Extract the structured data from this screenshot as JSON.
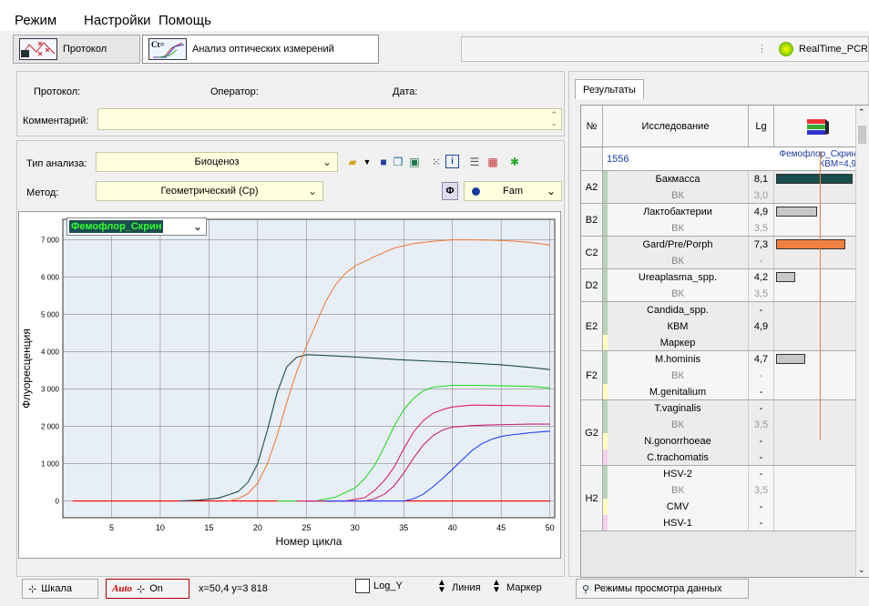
{
  "menu": {
    "items": [
      "Режим",
      "Настройки",
      "Помощь"
    ]
  },
  "toolbar": {
    "tab_protocol": "Протокол",
    "tab_analysis": "Анализ оптических измерений",
    "tab_analysis_icon_text": "Ct=",
    "realtime": "RealTime_PCR"
  },
  "info": {
    "protocol_label": "Протокол:",
    "operator_label": "Оператор:",
    "date_label": "Дата:",
    "comment_label": "Комментарий:"
  },
  "analysis": {
    "type_label": "Тип анализа:",
    "type_value": "Биоценоз",
    "method_label": "Метод:",
    "method_value": "Геометрический (Cp)",
    "channel_value": "Fam",
    "phi_symbol": "Φ"
  },
  "chart_selector": "Фемофлор_Скрин",
  "chart_data": {
    "type": "line",
    "xlabel": "Номер цикла",
    "ylabel": "Флуоресценция",
    "xlim": [
      0,
      50.5
    ],
    "ylim": [
      -450,
      7550
    ],
    "x_ticks": [
      5,
      10,
      15,
      20,
      25,
      30,
      35,
      40,
      45,
      50
    ],
    "y_ticks": [
      0,
      1000,
      2000,
      3000,
      4000,
      5000,
      6000,
      7000
    ],
    "y_tick_labels": [
      "0",
      "1 000",
      "2 000",
      "3 000",
      "4 000",
      "5 000",
      "6 000",
      "7 000"
    ],
    "grid": true,
    "series": [
      {
        "color": "#ff0000",
        "x": [
          1,
          10,
          20,
          30,
          40,
          50
        ],
        "y": [
          0,
          0,
          0,
          0,
          0,
          0
        ]
      },
      {
        "color": "#1a4d4d",
        "x": [
          12,
          14,
          16,
          18,
          19,
          20,
          21,
          22,
          23,
          24,
          25,
          27,
          30,
          35,
          40,
          45,
          48,
          50
        ],
        "y": [
          0,
          20,
          80,
          250,
          500,
          1000,
          1900,
          2900,
          3600,
          3850,
          3920,
          3900,
          3860,
          3780,
          3720,
          3650,
          3580,
          3520
        ]
      },
      {
        "color": "#f08040",
        "x": [
          17,
          18,
          19,
          20,
          21,
          22,
          23,
          24,
          25,
          26,
          27,
          28,
          29,
          30,
          32,
          34,
          36,
          38,
          40,
          42,
          44,
          46,
          48,
          50
        ],
        "y": [
          0,
          60,
          200,
          480,
          1000,
          1750,
          2650,
          3450,
          4150,
          4750,
          5350,
          5800,
          6100,
          6300,
          6550,
          6780,
          6900,
          6960,
          7000,
          7000,
          6990,
          6970,
          6930,
          6860
        ]
      },
      {
        "color": "#22dd22",
        "x": [
          22,
          26,
          28,
          30,
          31,
          32,
          33,
          34,
          35,
          36,
          37,
          38,
          40,
          42,
          45,
          48,
          50
        ],
        "y": [
          0,
          0,
          100,
          350,
          600,
          950,
          1450,
          2000,
          2450,
          2750,
          2950,
          3050,
          3100,
          3100,
          3090,
          3070,
          3030
        ]
      },
      {
        "color": "#e0206a",
        "x": [
          24,
          29,
          31,
          32,
          33,
          34,
          35,
          36,
          37,
          38,
          39,
          40,
          42,
          45,
          48,
          50
        ],
        "y": [
          0,
          0,
          90,
          280,
          550,
          900,
          1400,
          1850,
          2150,
          2350,
          2450,
          2520,
          2570,
          2560,
          2550,
          2540
        ]
      },
      {
        "color": "#c8207a",
        "x": [
          25,
          31,
          32,
          33,
          34,
          35,
          36,
          37,
          38,
          39,
          40,
          42,
          44,
          46,
          48,
          50
        ],
        "y": [
          0,
          0,
          60,
          180,
          400,
          750,
          1150,
          1500,
          1750,
          1900,
          1980,
          2020,
          2040,
          2050,
          2060,
          2060
        ]
      },
      {
        "color": "#2040ff",
        "x": [
          27,
          35,
          36,
          37,
          38,
          39,
          40,
          41,
          42,
          43,
          44,
          45,
          46,
          47,
          48,
          49,
          50
        ],
        "y": [
          0,
          0,
          60,
          180,
          380,
          600,
          850,
          1100,
          1350,
          1530,
          1650,
          1730,
          1770,
          1800,
          1830,
          1850,
          1870
        ]
      }
    ]
  },
  "bottom": {
    "scale_btn": "Шкала",
    "auto_label": "Auto",
    "on_label": "On",
    "coords": "x=50,4 y=3 818",
    "log_y": "Log_Y",
    "line_btn": "Линия",
    "marker_btn": "Маркер",
    "view_modes_btn": "Режимы просмотра данных"
  },
  "results": {
    "tab": "Результаты",
    "header": {
      "num": "№",
      "study": "Исследование",
      "lg": "Lg"
    },
    "sample": {
      "id": "1556",
      "name": "Фемофлор_Скрин",
      "kvm": "КВМ=4,9"
    },
    "groups": [
      {
        "well": "A2",
        "rows": [
          {
            "name": "Бакмасса",
            "lg": "8,1",
            "bar": 1.0,
            "bar_color": "#1a4d4d",
            "muted": false,
            "stripe": "#b8d4b8"
          },
          {
            "name": "ВК",
            "lg": "3,0",
            "muted": true,
            "stripe": "#b8d4b8"
          }
        ]
      },
      {
        "well": "B2",
        "rows": [
          {
            "name": "Лактобактерии",
            "lg": "4,9",
            "bar": 0.53,
            "bar_color": "#c8c8c8",
            "muted": false,
            "stripe": "#b8d4b8"
          },
          {
            "name": "ВК",
            "lg": "3,5",
            "muted": true,
            "stripe": "#b8d4b8"
          }
        ]
      },
      {
        "well": "C2",
        "rows": [
          {
            "name": "Gard/Pre/Porph",
            "lg": "7,3",
            "bar": 0.9,
            "bar_color": "#f08040",
            "muted": false,
            "stripe": "#b8d4b8"
          },
          {
            "name": "ВК",
            "lg": "-",
            "muted": true,
            "stripe": "#b8d4b8"
          }
        ]
      },
      {
        "well": "D2",
        "rows": [
          {
            "name": "Ureaplasma_spp.",
            "lg": "4,2",
            "bar": 0.25,
            "bar_color": "#c8c8c8",
            "muted": false,
            "stripe": "#b8d4b8"
          },
          {
            "name": "ВК",
            "lg": "3,5",
            "muted": true,
            "stripe": "#b8d4b8"
          }
        ]
      },
      {
        "well": "E2",
        "rows": [
          {
            "name": "Candida_spp.",
            "lg": "-",
            "muted": false,
            "stripe": "#b8d4b8"
          },
          {
            "name": "КВМ",
            "lg": "4,9",
            "muted": false,
            "stripe": "#b8d4b8"
          },
          {
            "name": "Маркер",
            "lg": "",
            "muted": false,
            "stripe": "#ffffc0"
          }
        ]
      },
      {
        "well": "F2",
        "rows": [
          {
            "name": "M.hominis",
            "lg": "4,7",
            "bar": 0.38,
            "bar_color": "#c8c8c8",
            "muted": false,
            "stripe": "#b8d4b8"
          },
          {
            "name": "ВК",
            "lg": "-",
            "muted": true,
            "stripe": "#b8d4b8"
          },
          {
            "name": "M.genitalium",
            "lg": "-",
            "muted": false,
            "stripe": "#ffffc0"
          }
        ]
      },
      {
        "well": "G2",
        "rows": [
          {
            "name": "T.vaginalis",
            "lg": "-",
            "muted": false,
            "stripe": "#b8d4b8"
          },
          {
            "name": "ВК",
            "lg": "3,5",
            "muted": true,
            "stripe": "#b8d4b8"
          },
          {
            "name": "N.gonorrhoeae",
            "lg": "-",
            "muted": false,
            "stripe": "#ffffc0"
          },
          {
            "name": "C.trachomatis",
            "lg": "-",
            "muted": false,
            "stripe": "#f8d0f0"
          }
        ]
      },
      {
        "well": "H2",
        "rows": [
          {
            "name": "HSV-2",
            "lg": "-",
            "muted": false,
            "stripe": "#b8d4b8"
          },
          {
            "name": "ВК",
            "lg": "3,5",
            "muted": true,
            "stripe": "#b8d4b8"
          },
          {
            "name": "CMV",
            "lg": "-",
            "muted": false,
            "stripe": "#ffffc0"
          },
          {
            "name": "HSV-1",
            "lg": "-",
            "muted": false,
            "stripe": "#f8d0f0"
          }
        ]
      }
    ]
  }
}
